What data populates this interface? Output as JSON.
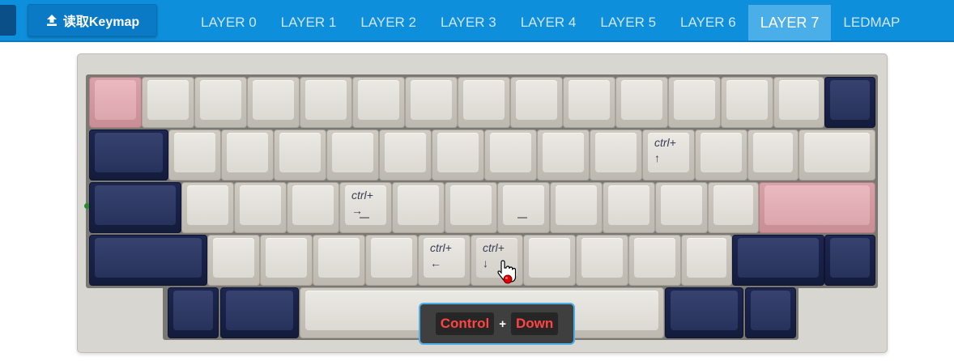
{
  "topbar": {
    "read_button_label": "读取Keymap",
    "tabs": [
      {
        "label": "LAYER 0"
      },
      {
        "label": "LAYER 1"
      },
      {
        "label": "LAYER 2"
      },
      {
        "label": "LAYER 3"
      },
      {
        "label": "LAYER 4"
      },
      {
        "label": "LAYER 5"
      },
      {
        "label": "LAYER 6"
      },
      {
        "label": "LAYER 7",
        "active": true
      },
      {
        "label": "LEDMAP"
      }
    ]
  },
  "keyboard": {
    "legends": {
      "ctrl_up": {
        "mod": "ctrl+",
        "arrow": "↑"
      },
      "ctrl_right": {
        "mod": "ctrl+",
        "arrow": "→"
      },
      "ctrl_left": {
        "mod": "ctrl+",
        "arrow": "←"
      },
      "ctrl_down": {
        "mod": "ctrl+",
        "arrow": "↓"
      }
    }
  },
  "tooltip": {
    "key1": "Control",
    "plus": "+",
    "key2": "Down"
  },
  "colors": {
    "topbar": "#0e8fdc",
    "active_tab": "#4aaee8",
    "beige_key": "#e6e3de",
    "navy_key": "#2b3560",
    "pink_key": "#e3b1b7",
    "tooltip_text": "#ff4444"
  }
}
